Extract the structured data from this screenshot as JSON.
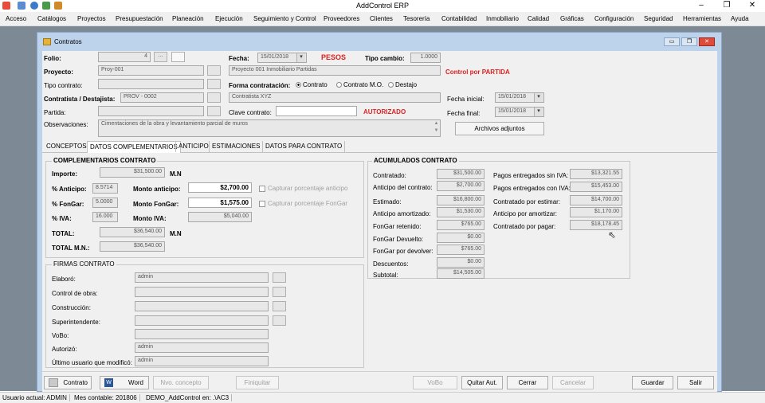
{
  "app": {
    "title": "AddControl ERP"
  },
  "menu": [
    "Acceso",
    "Catálogos",
    "Proyectos",
    "Presupuestación",
    "Planeación",
    "Ejecución",
    "Seguimiento y Control",
    "Proveedores",
    "Clientes",
    "Tesorería",
    "Contabilidad",
    "Inmobiliario",
    "Calidad",
    "Gráficas",
    "Configuración",
    "Seguridad",
    "Herramientas",
    "Ayuda"
  ],
  "window": {
    "title": "Contratos"
  },
  "header": {
    "folio_label": "Folio:",
    "folio_value": "4",
    "proyecto_label": "Proyecto:",
    "proyecto_value": "Proy-001",
    "tipo_contrato_label": "Tipo contrato:",
    "contratista_label": "Contratista / Destajista:",
    "contratista_value": "PROV - 0002",
    "partida_label": "Partida:",
    "observaciones_label": "Observaciones:",
    "observaciones_value": "Cimentaciones de la obra y levantamiento parcial de muros",
    "fecha_label": "Fecha:",
    "fecha_value": "15/01/2018",
    "moneda": "PESOS",
    "tipo_cambio_label": "Tipo cambio:",
    "tipo_cambio_value": "1.0000",
    "proyecto_nombre": "Proyecto 001 Inmobiliario Partidas",
    "control_por": "Control por PARTIDA",
    "forma_label": "Forma contratación:",
    "forma_options": [
      "Contrato",
      "Contrato M.O.",
      "Destajo"
    ],
    "contratista_nombre": "Contratista XYZ",
    "clave_label": "Clave contrato:",
    "estado": "AUTORIZADO",
    "fecha_inicial_label": "Fecha inicial:",
    "fecha_inicial_value": "15/01/2018",
    "fecha_final_label": "Fecha final:",
    "fecha_final_value": "15/01/2018",
    "archivos_label": "Archivos adjuntos"
  },
  "tabs": [
    "CONCEPTOS",
    "DATOS COMPLEMENTARIOS",
    "ANTICIPO",
    "ESTIMACIONES",
    "DATOS PARA CONTRATO"
  ],
  "complementarios": {
    "group_title": "COMPLEMENTARIOS CONTRATO",
    "importe_label": "Importe:",
    "importe_value": "$31,500.00",
    "mn1": "M.N",
    "anticipo_pct_label": "% Anticipo:",
    "anticipo_pct_value": "8.5714",
    "fongar_pct_label": "% FonGar:",
    "fongar_pct_value": "5.0000",
    "iva_pct_label": "% IVA:",
    "iva_pct_value": "16.000",
    "monto_anticipo_label": "Monto anticipo:",
    "monto_anticipo_value": "$2,700.00",
    "monto_fongar_label": "Monto FonGar:",
    "monto_fongar_value": "$1,575.00",
    "monto_iva_label": "Monto IVA:",
    "monto_iva_value": "$5,040.00",
    "capturar_anticipo": "Capturar porcentaje anticipo",
    "capturar_fongar": "Capturar porcentaje FonGar",
    "total_label": "TOTAL:",
    "total_value": "$36,540.00",
    "mn2": "M.N",
    "total_mn_label": "TOTAL M.N.:",
    "total_mn_value": "$36,540.00"
  },
  "firmas": {
    "group_title": "FIRMAS CONTRATO",
    "rows": [
      {
        "label": "Elaboró:",
        "value": "admin"
      },
      {
        "label": "Control de obra:",
        "value": ""
      },
      {
        "label": "Construcción:",
        "value": ""
      },
      {
        "label": "Superintendente:",
        "value": ""
      },
      {
        "label": "VoBo:",
        "value": ""
      },
      {
        "label": "Autorizó:",
        "value": "admin"
      },
      {
        "label": "Último usuario que modificó:",
        "value": "admin"
      }
    ]
  },
  "acumulados": {
    "group_title": "ACUMULADOS CONTRATO",
    "left": [
      {
        "label": "Contratado:",
        "value": "$31,500.00"
      },
      {
        "label": "Anticipo del contrato:",
        "value": "$2,700.00"
      },
      {
        "label": "Estimado:",
        "value": "$16,800.00"
      },
      {
        "label": "Anticipo amortizado:",
        "value": "$1,530.00"
      },
      {
        "label": "FonGar retenido:",
        "value": "$765.00"
      },
      {
        "label": "FonGar Devuelto:",
        "value": "$0.00"
      },
      {
        "label": "FonGar por devolver:",
        "value": "$765.00"
      },
      {
        "label": "Descuentos:",
        "value": "$0.00"
      },
      {
        "label": "Subtotal:",
        "value": "$14,505.00"
      }
    ],
    "right": [
      {
        "label": "Pagos entregados sin IVA:",
        "value": "$13,321.55"
      },
      {
        "label": "Pagos entregados con IVA:",
        "value": "$15,453.00"
      },
      {
        "label": "Contratado por estimar:",
        "value": "$14,700.00"
      },
      {
        "label": "Anticipo por amortizar:",
        "value": "$1,170.00"
      },
      {
        "label": "Contratado por pagar:",
        "value": "$18,178.45"
      }
    ]
  },
  "buttons": {
    "contrato": "Contrato",
    "word": "Word",
    "nvo_concepto": "Nvo. concepto",
    "finiquitar": "Finiquitar",
    "vobo": "VoBo",
    "quitar_aut": "Quitar Aut.",
    "cerrar": "Cerrar",
    "cancelar": "Cancelar",
    "guardar": "Guardar",
    "salir": "Salir"
  },
  "status": {
    "usuario": "Usuario actual: ADMIN",
    "mes": "Mes contable: 201806",
    "demo": "DEMO_AddControl en: .\\AC3"
  },
  "colors": {
    "accent_red": "#e0201e",
    "mdi_bg": "#7d8a96",
    "window_frame": "#bdd3ec"
  }
}
